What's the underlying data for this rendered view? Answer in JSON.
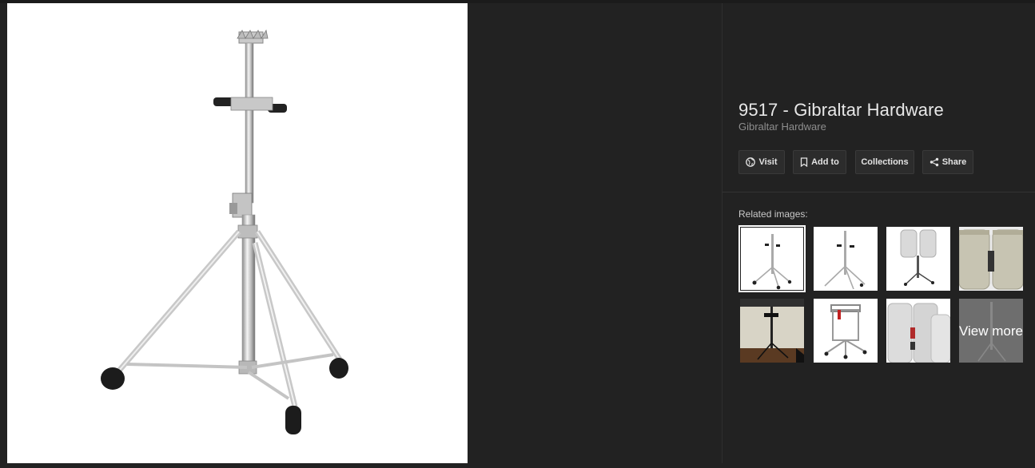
{
  "result": {
    "title": "9517 - Gibraltar Hardware",
    "source": "Gibraltar Hardware"
  },
  "actions": {
    "visit": "Visit",
    "add_to": "Add to",
    "collections": "Collections",
    "share": "Share"
  },
  "related": {
    "label": "Related images:",
    "view_more": "View more",
    "thumbnails": [
      "stand-white-1",
      "stand-white-2",
      "congas-on-stand",
      "conga-closeup",
      "stand-in-room",
      "conga-cradle",
      "conga-pair",
      "view-more"
    ]
  },
  "colors": {
    "background": "#222222",
    "button_bg": "#2c2c2c",
    "text": "#e8e8e8",
    "muted": "#8e8e8e"
  }
}
